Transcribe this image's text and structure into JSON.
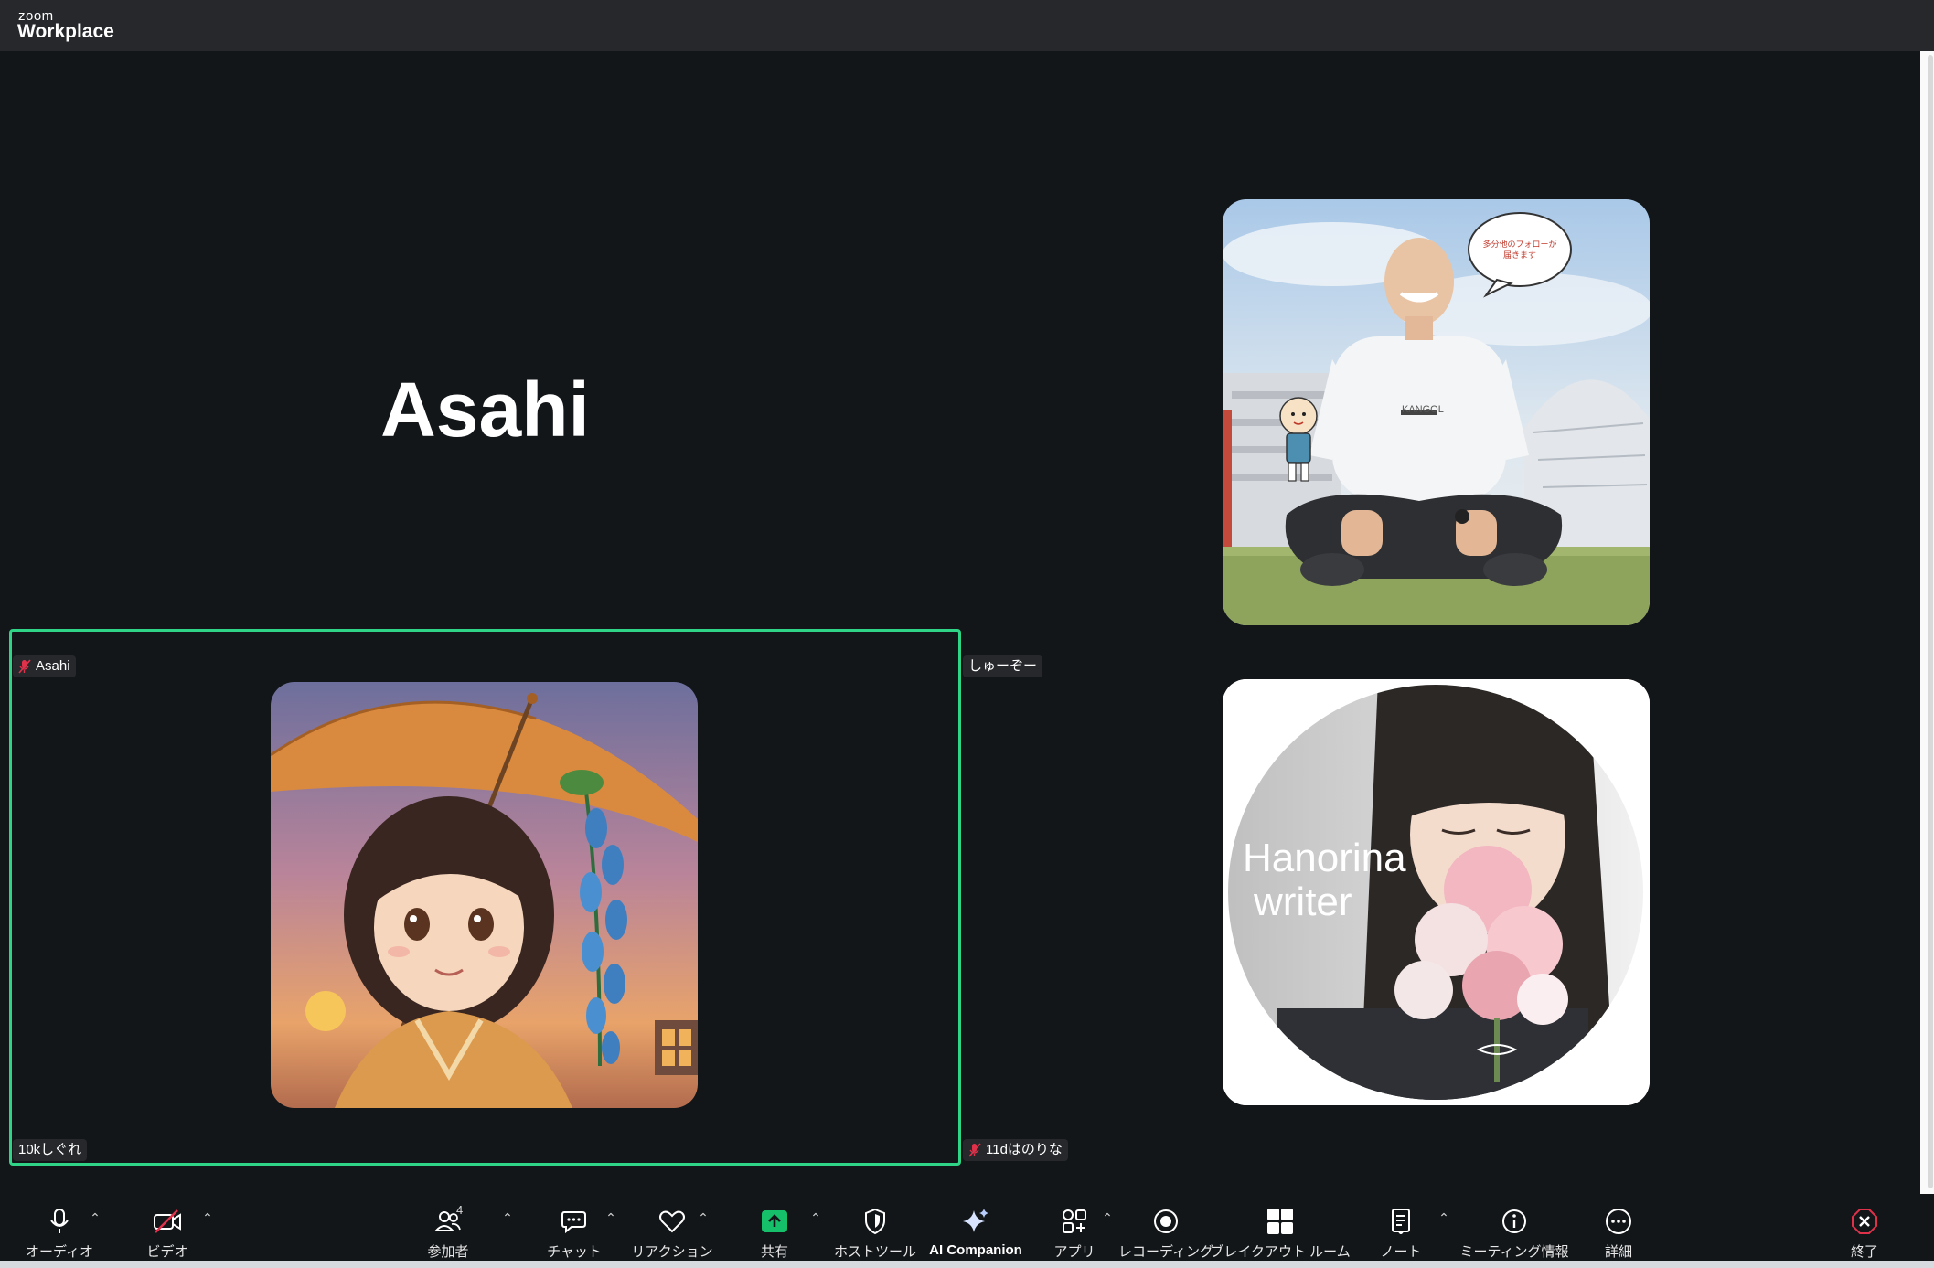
{
  "app": {
    "brand_small": "zoom",
    "brand_main": "Workplace"
  },
  "tiles": [
    {
      "id": "asahi-tile",
      "name_big": "Asahi",
      "name_tag": "Asahi",
      "muted": true,
      "active": false
    },
    {
      "id": "shuzo-tile",
      "name_tag": "しゅーぞー",
      "muted": false,
      "active": false,
      "speech_bubble": "多分他のフォローが\n届きます",
      "shirt_text": "KANGOL"
    },
    {
      "id": "shigure-tile",
      "name_tag": "10kしぐれ",
      "muted": false,
      "active": true
    },
    {
      "id": "hanorina-tile",
      "name_tag": "11dはのりな",
      "muted": true,
      "active": false,
      "avatar_text_line1": "Hanorina",
      "avatar_text_line2": "writer"
    }
  ],
  "toolbar": {
    "audio": "オーディオ",
    "video": "ビデオ",
    "participants": "参加者",
    "participants_count": "4",
    "chat": "チャット",
    "reactions": "リアクション",
    "share": "共有",
    "host_tools": "ホストツール",
    "ai_companion": "AI Companion",
    "apps": "アプリ",
    "recording": "レコーディング",
    "breakout": "ブレイクアウト ルーム",
    "notes": "ノート",
    "meeting_info": "ミーティング情報",
    "more": "詳細",
    "end": "終了"
  },
  "colors": {
    "background": "#121619",
    "active_speaker_border": "#2fd486",
    "share_green": "#16c06a",
    "end_red": "#e0314b",
    "mute_red": "#e0314b"
  }
}
